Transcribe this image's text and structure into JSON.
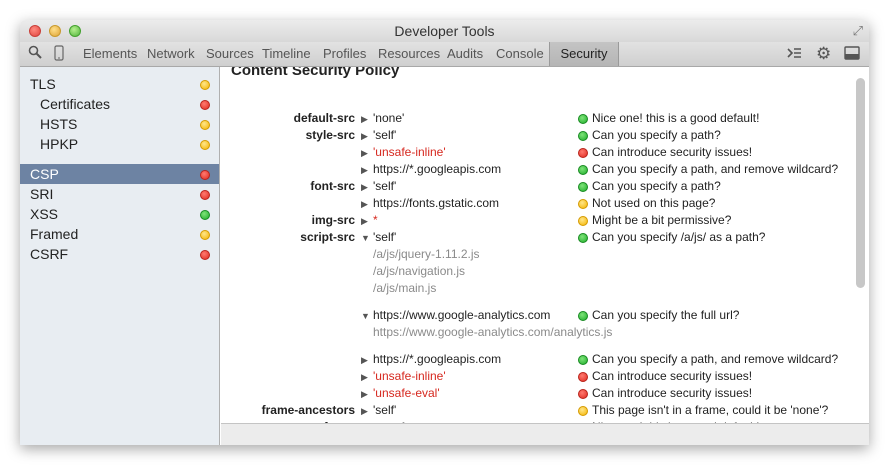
{
  "window": {
    "title": "Developer Tools"
  },
  "toolbar": {
    "tabs": [
      "Elements",
      "Network",
      "Sources",
      "Timeline",
      "Profiles",
      "Resources",
      "Audits",
      "Console",
      "Security"
    ],
    "active_tab": "Security",
    "icons": [
      "search-icon",
      "device-icon",
      "console-drawer-icon",
      "gear-icon",
      "dock-icon"
    ]
  },
  "sidebar": {
    "items": [
      {
        "label": "TLS",
        "status": "yellow"
      },
      {
        "label": "Certificates",
        "status": "red"
      },
      {
        "label": "HSTS",
        "status": "yellow"
      },
      {
        "label": "HPKP",
        "status": "yellow"
      },
      {
        "label": "CSP",
        "status": "red",
        "selected": true
      },
      {
        "label": "SRI",
        "status": "red"
      },
      {
        "label": "XSS",
        "status": "green"
      },
      {
        "label": "Framed",
        "status": "yellow"
      },
      {
        "label": "CSRF",
        "status": "red"
      }
    ]
  },
  "main": {
    "section_title": "Content Security Policy",
    "rows": [
      {
        "directive": "default-src",
        "arrow": "▶",
        "value": "'none'",
        "value_style": "normal",
        "status": "green",
        "message": "Nice one! this is a good default!"
      },
      {
        "directive": "style-src",
        "arrow": "▶",
        "value": "'self'",
        "value_style": "normal",
        "status": "green",
        "message": "Can you specify a path?"
      },
      {
        "directive": "",
        "arrow": "▶",
        "value": "'unsafe-inline'",
        "value_style": "red",
        "status": "red",
        "message": "Can introduce security issues!"
      },
      {
        "directive": "",
        "arrow": "▶",
        "value": "https://*.googleapis.com",
        "value_style": "normal",
        "status": "green",
        "message": "Can you specify a path, and remove wildcard?"
      },
      {
        "directive": "font-src",
        "arrow": "▶",
        "value": "'self'",
        "value_style": "normal",
        "status": "green",
        "message": "Can you specify a path?"
      },
      {
        "directive": "",
        "arrow": "▶",
        "value": "https://fonts.gstatic.com",
        "value_style": "normal",
        "status": "yellow",
        "message": "Not used on this page?"
      },
      {
        "directive": "img-src",
        "arrow": "▶",
        "value": "*",
        "value_style": "red",
        "status": "yellow",
        "message": "Might be a bit permissive?"
      },
      {
        "directive": "script-src",
        "arrow": "▼",
        "value": "'self'",
        "value_style": "normal",
        "status": "green",
        "message": "Can you specify /a/js/ as a path?"
      },
      {
        "directive": "",
        "arrow": "",
        "value": "/a/js/jquery-1.11.2.js",
        "value_style": "gray",
        "status": "",
        "message": ""
      },
      {
        "directive": "",
        "arrow": "",
        "value": "/a/js/navigation.js",
        "value_style": "gray",
        "status": "",
        "message": ""
      },
      {
        "directive": "",
        "arrow": "",
        "value": "/a/js/main.js",
        "value_style": "gray",
        "status": "",
        "message": ""
      },
      {
        "directive": "",
        "arrow": "▼",
        "value": "https://www.google-analytics.com",
        "value_style": "normal",
        "status": "green",
        "message": "Can you specify the full url?"
      },
      {
        "directive": "",
        "arrow": "",
        "value": "https://www.google-analytics.com/analytics.js",
        "value_style": "gray",
        "status": "",
        "message": ""
      },
      {
        "directive": "",
        "arrow": "▶",
        "value": "https://*.googleapis.com",
        "value_style": "normal",
        "status": "green",
        "message": "Can you specify a path, and remove wildcard?"
      },
      {
        "directive": "",
        "arrow": "▶",
        "value": "'unsafe-inline'",
        "value_style": "red",
        "status": "red",
        "message": "Can introduce security issues!"
      },
      {
        "directive": "",
        "arrow": "▶",
        "value": "'unsafe-eval'",
        "value_style": "red",
        "status": "red",
        "message": "Can introduce security issues!"
      },
      {
        "directive": "frame-ancestors",
        "arrow": "▶",
        "value": "'self'",
        "value_style": "normal",
        "status": "yellow",
        "message": "This page isn't in a frame, could it be 'none'?"
      },
      {
        "directive": "referrer",
        "arrow": "▶",
        "value": "no-referrer",
        "value_style": "normal",
        "status": "green",
        "message": "Nice one! this is a good default!"
      }
    ]
  }
}
